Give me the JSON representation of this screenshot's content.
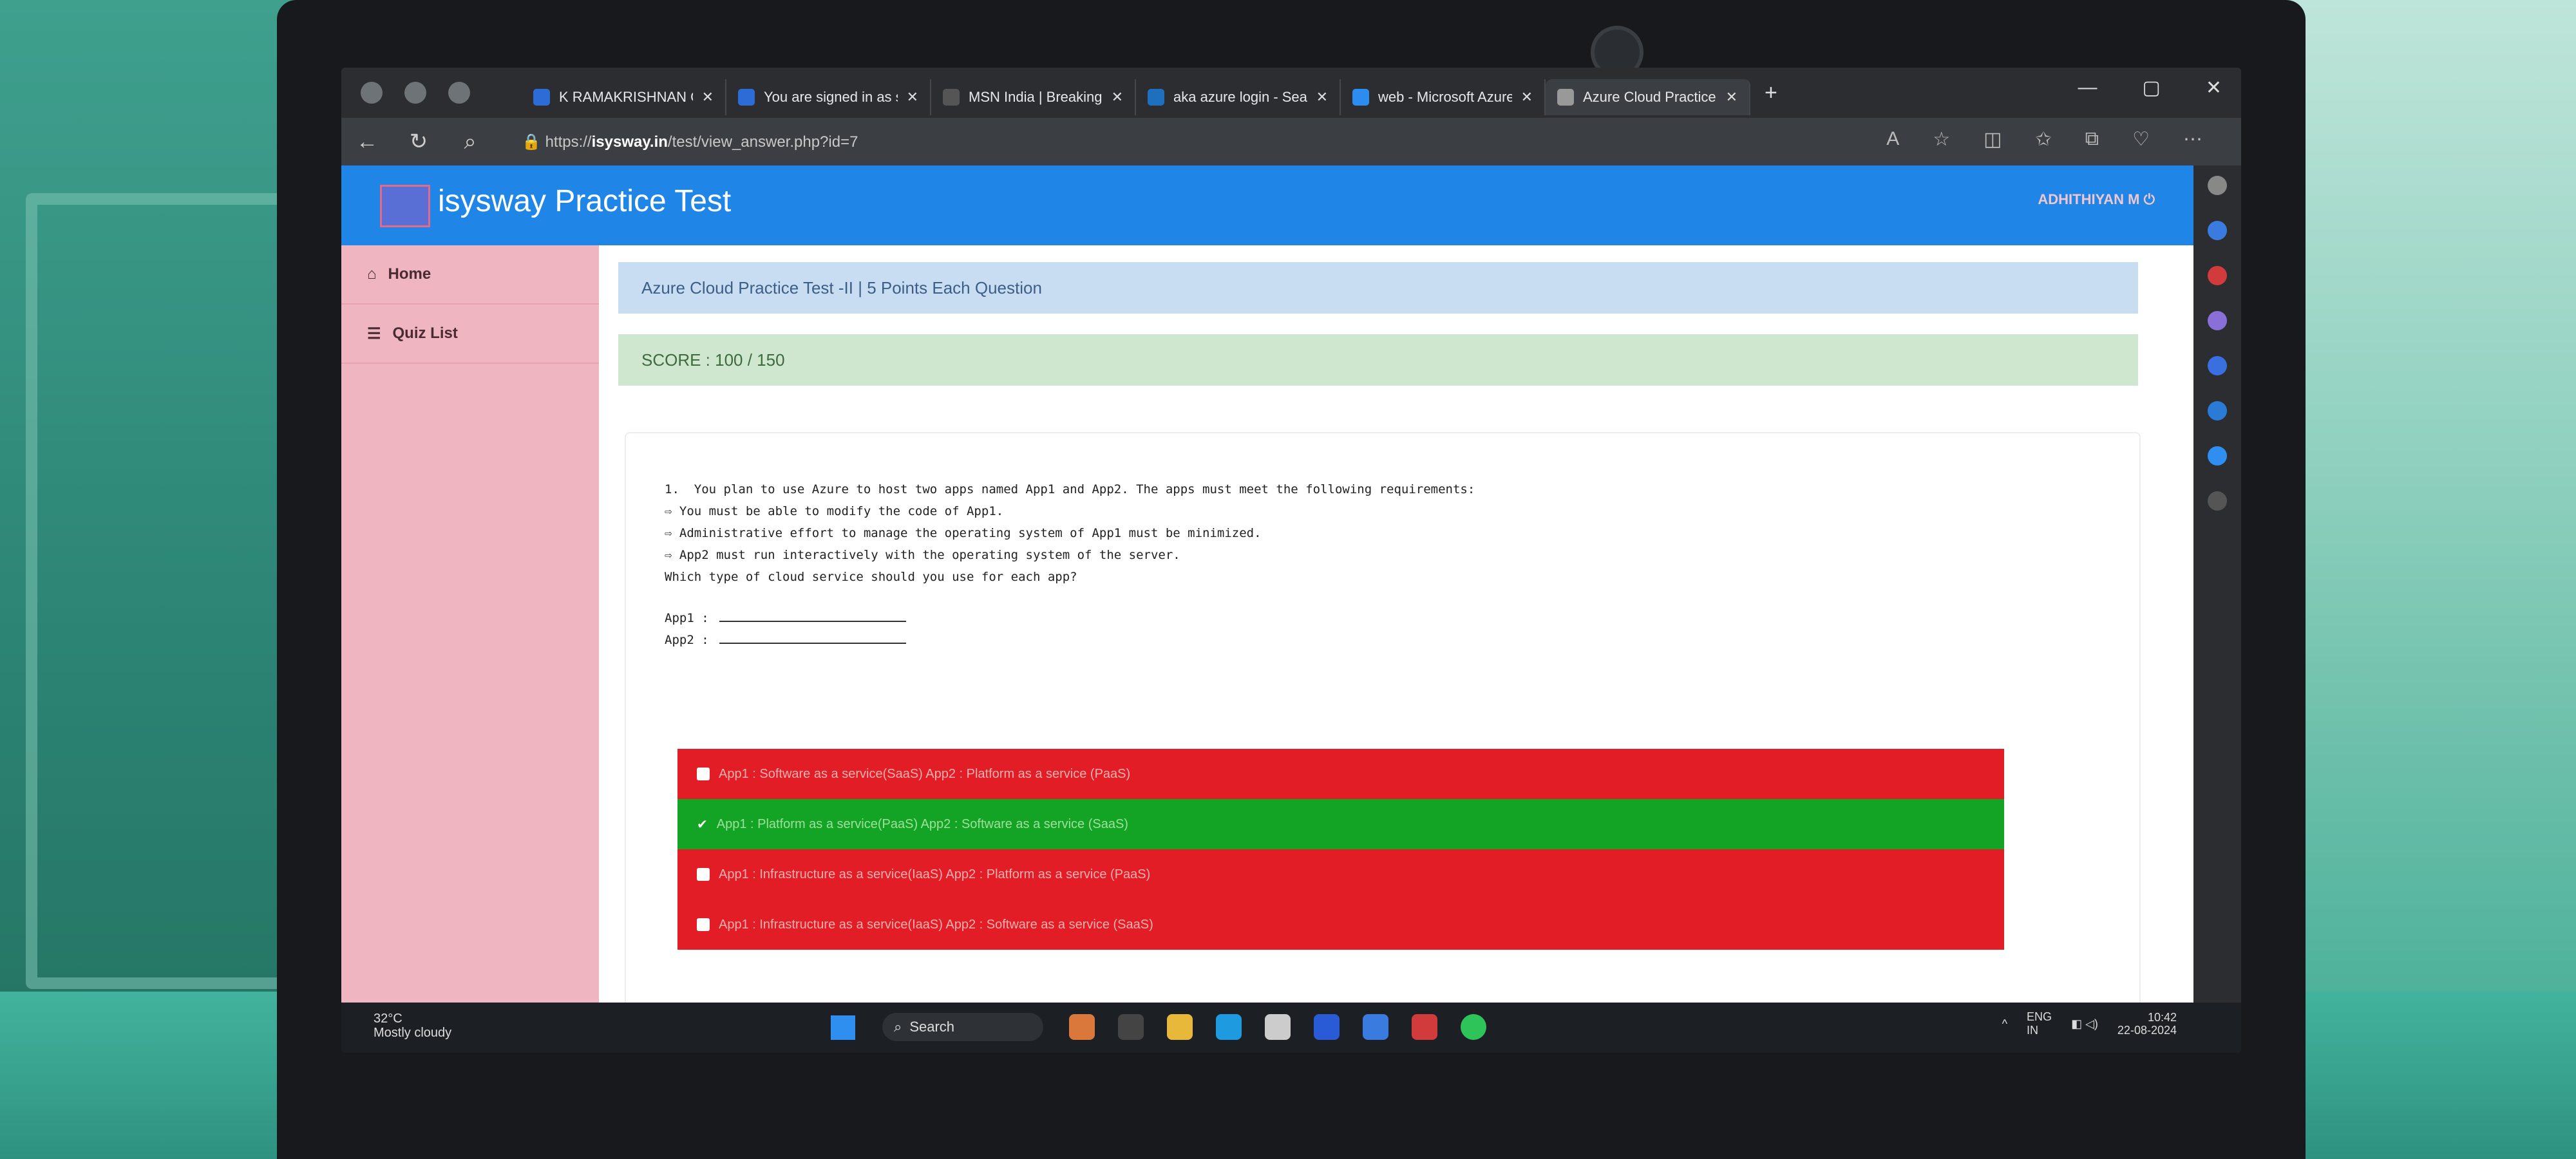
{
  "browser": {
    "tabs": [
      {
        "label": "K RAMAKRISHNAN GRO",
        "active": false
      },
      {
        "label": "You are signed in as stu",
        "active": false
      },
      {
        "label": "MSN India | Breaking Ne",
        "active": false
      },
      {
        "label": "aka azure login - Search",
        "active": false
      },
      {
        "label": "web - Microsoft Azure",
        "active": false
      },
      {
        "label": "Azure Cloud Practice Te",
        "active": true
      }
    ],
    "url_prefix": "https://",
    "url_host": "isysway.in",
    "url_path": "/test/view_answer.php?id=7"
  },
  "header": {
    "brand": "isysway Practice Test",
    "user": "ADHITHIYAN M"
  },
  "nav": {
    "home": "Home",
    "quiz_list": "Quiz List"
  },
  "quiz": {
    "title": "Azure Cloud Practice Test -II | 5 Points Each Question",
    "score": "SCORE : 100 / 150"
  },
  "question": {
    "lines": [
      "1.  You plan to use Azure to host two apps named App1 and App2. The apps must meet the following requirements:",
      "⇨ You must be able to modify the code of App1.",
      "⇨ Administrative effort to manage the operating system of App1 must be minimized.",
      "⇨ App2 must run interactively with the operating system of the server.",
      "Which type of cloud service should you use for each app?"
    ],
    "blank1": "App1 :",
    "blank2": "App2 :"
  },
  "options": [
    {
      "label": "App1 : Software as a service(SaaS) App2 : Platform as a service (PaaS)",
      "status": "wrong",
      "checked": false
    },
    {
      "label": "App1 : Platform as a service(PaaS) App2 : Software as a service (SaaS)",
      "status": "right",
      "checked": true
    },
    {
      "label": "App1 : Infrastructure as a service(IaaS) App2 : Platform as a service (PaaS)",
      "status": "wrong",
      "checked": false
    },
    {
      "label": "App1 : Infrastructure as a service(IaaS) App2 : Software as a service (SaaS)",
      "status": "wrong",
      "checked": false
    }
  ],
  "taskbar": {
    "temp": "32°C",
    "weather": "Mostly cloudy",
    "search": "Search",
    "lang1": "ENG",
    "lang2": "IN",
    "time": "10:42",
    "date": "22-08-2024"
  },
  "colors": {
    "header": "#1f86e8",
    "wrong": "#e21d26",
    "right": "#13a325",
    "sidebar": "#efb5c1"
  }
}
